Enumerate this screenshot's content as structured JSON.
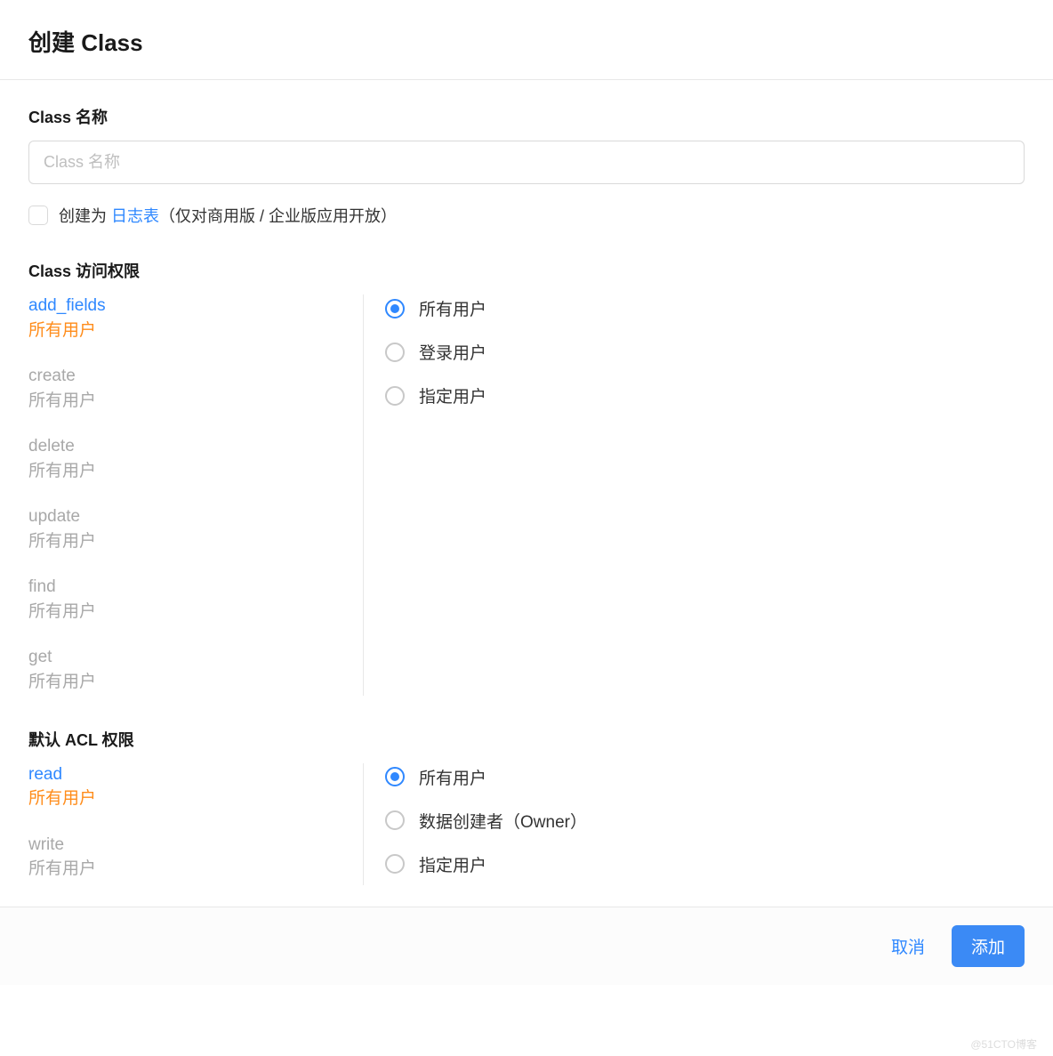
{
  "header": {
    "title": "创建 Class"
  },
  "form": {
    "name_label": "Class 名称",
    "name_placeholder": "Class 名称",
    "name_value": "",
    "logtable_prefix": "创建为 ",
    "logtable_link": "日志表",
    "logtable_suffix": "（仅对商用版 / 企业版应用开放）"
  },
  "class_perm": {
    "section_label": "Class 访问权限",
    "items": [
      {
        "name": "add_fields",
        "value": "所有用户",
        "active": true
      },
      {
        "name": "create",
        "value": "所有用户",
        "active": false
      },
      {
        "name": "delete",
        "value": "所有用户",
        "active": false
      },
      {
        "name": "update",
        "value": "所有用户",
        "active": false
      },
      {
        "name": "find",
        "value": "所有用户",
        "active": false
      },
      {
        "name": "get",
        "value": "所有用户",
        "active": false
      }
    ],
    "options": [
      {
        "label": "所有用户",
        "selected": true
      },
      {
        "label": "登录用户",
        "selected": false
      },
      {
        "label": "指定用户",
        "selected": false
      }
    ]
  },
  "acl_perm": {
    "section_label": "默认 ACL 权限",
    "items": [
      {
        "name": "read",
        "value": "所有用户",
        "active": true
      },
      {
        "name": "write",
        "value": "所有用户",
        "active": false
      }
    ],
    "options": [
      {
        "label": "所有用户",
        "selected": true
      },
      {
        "label": "数据创建者（Owner）",
        "selected": false
      },
      {
        "label": "指定用户",
        "selected": false
      }
    ]
  },
  "footer": {
    "cancel": "取消",
    "submit": "添加"
  },
  "watermark": "@51CTO博客"
}
